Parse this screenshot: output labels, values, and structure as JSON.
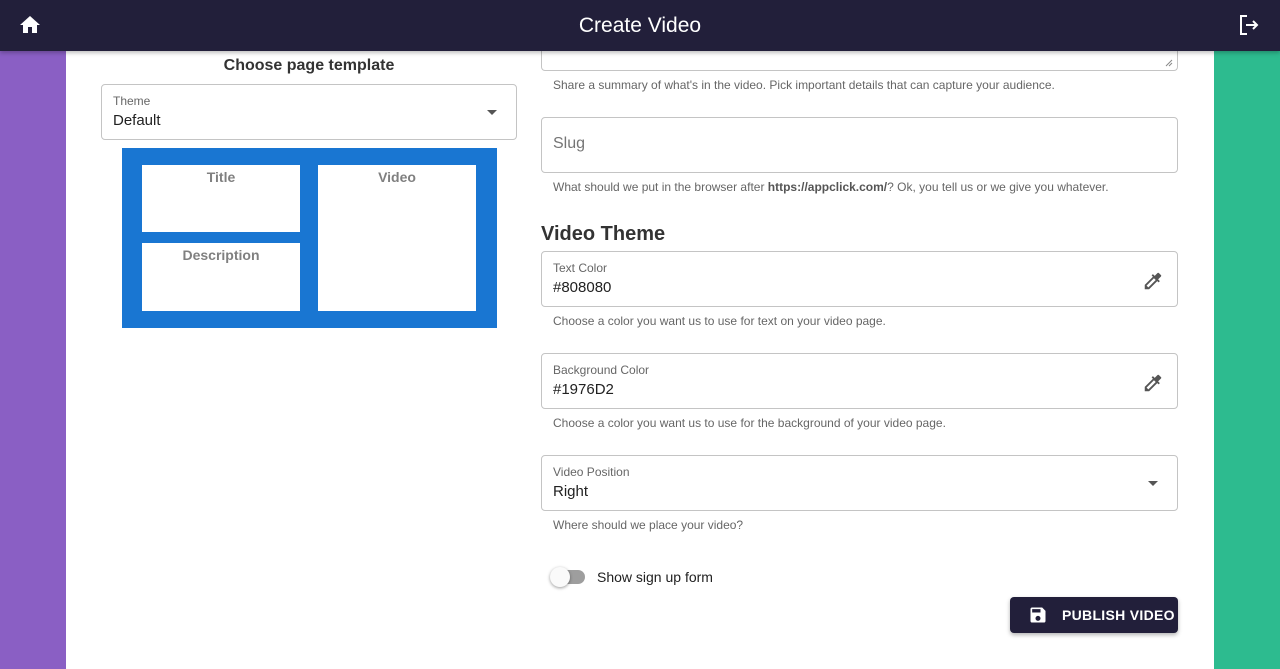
{
  "header": {
    "title": "Create Video",
    "home_icon": "home-icon",
    "logout_icon": "logout-icon",
    "color": "#221f3a"
  },
  "template": {
    "heading": "Choose page template",
    "theme_label": "Theme",
    "theme_value": "Default",
    "preview": {
      "background": "#1976D2",
      "title_label": "Title",
      "description_label": "Description",
      "video_label": "Video"
    }
  },
  "form": {
    "description_helper": "Share a summary of what's in the video. Pick important details that can capture your audience.",
    "slug": {
      "placeholder": "Slug",
      "helper_prefix": "What should we put in the browser after ",
      "helper_url": "https://appclick.com/",
      "helper_suffix": "? Ok, you tell us or we give you whatever."
    },
    "video_theme": {
      "heading": "Video Theme",
      "text_color": {
        "label": "Text Color",
        "value": "#808080",
        "helper": "Choose a color you want us to use for text on your video page."
      },
      "background_color": {
        "label": "Background Color",
        "value": "#1976D2",
        "helper": "Choose a color you want us to use for the background of your video page."
      },
      "video_position": {
        "label": "Video Position",
        "value": "Right",
        "helper": "Where should we place your video?"
      }
    },
    "signup_toggle": {
      "label": "Show sign up form",
      "enabled": false
    },
    "publish_label": "PUBLISH VIDEO"
  },
  "colors": {
    "left_accent": "#8a5fc4",
    "right_accent": "#2dbb8f",
    "primary": "#221f3a"
  }
}
